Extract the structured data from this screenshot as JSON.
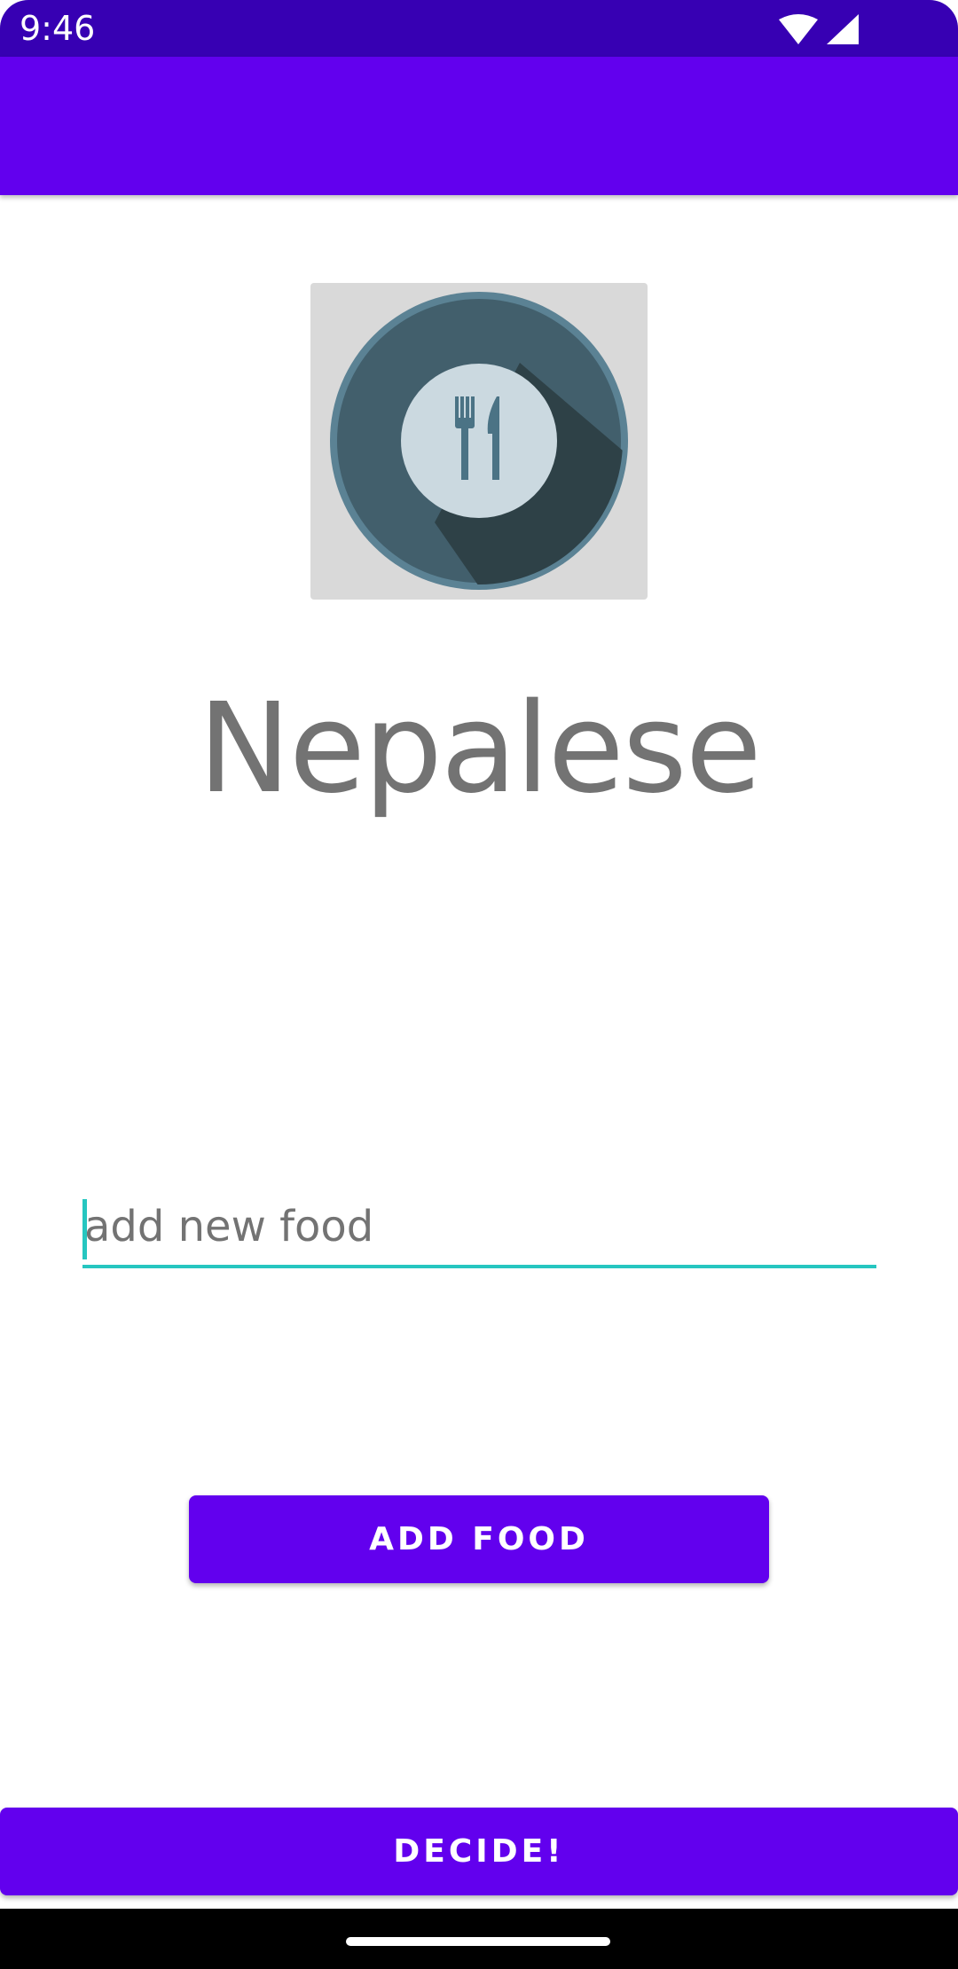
{
  "status_bar": {
    "time": "9:46",
    "icons": [
      "wifi-icon",
      "signal-icon"
    ],
    "color": "#3700b3"
  },
  "app_bar": {
    "color": "#6200ee"
  },
  "food_image": {
    "icon": "plate-fork-knife-icon"
  },
  "food": {
    "name": "Nepalese"
  },
  "food_input": {
    "placeholder": "add new food",
    "value": ""
  },
  "buttons": {
    "add_food": "ADD FOOD",
    "decide": "DECIDE!"
  },
  "colors": {
    "primary": "#6200ee",
    "accent": "#26c6c0"
  }
}
